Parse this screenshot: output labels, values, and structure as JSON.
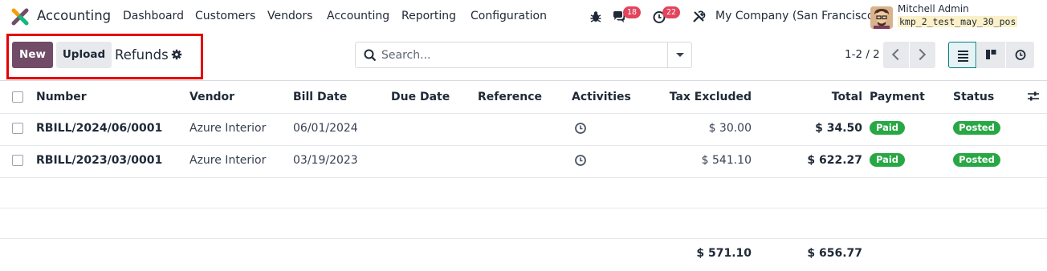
{
  "navbar": {
    "app_name": "Accounting",
    "menus": [
      "Dashboard",
      "Customers",
      "Vendors",
      "Accounting",
      "Reporting",
      "Configuration"
    ],
    "messages_count": "18",
    "activities_count": "22",
    "company": "My Company (San Francisco)",
    "user_name": "Mitchell Admin",
    "database": "kmp_2_test_may_30_pos"
  },
  "control": {
    "new_label": "New",
    "upload_label": "Upload",
    "title": "Refunds",
    "search_placeholder": "Search...",
    "pager": "1-2 / 2"
  },
  "table": {
    "columns": [
      "Number",
      "Vendor",
      "Bill Date",
      "Due Date",
      "Reference",
      "Activities",
      "Tax Excluded",
      "Total",
      "Payment",
      "Status"
    ],
    "rows": [
      {
        "number": "RBILL/2024/06/0001",
        "vendor": "Azure Interior",
        "bill_date": "06/01/2024",
        "due_date": "",
        "reference": "",
        "tax_excluded": "$ 30.00",
        "total": "$ 34.50",
        "payment": "Paid",
        "status": "Posted"
      },
      {
        "number": "RBILL/2023/03/0001",
        "vendor": "Azure Interior",
        "bill_date": "03/19/2023",
        "due_date": "",
        "reference": "",
        "tax_excluded": "$ 541.10",
        "total": "$ 622.27",
        "payment": "Paid",
        "status": "Posted"
      }
    ],
    "totals": {
      "tax_excluded": "$ 571.10",
      "total": "$ 656.77"
    }
  },
  "colors": {
    "brand": "#714b67",
    "paid": "#28a745",
    "badge": "#e2445c",
    "highlight": "#e50000"
  }
}
